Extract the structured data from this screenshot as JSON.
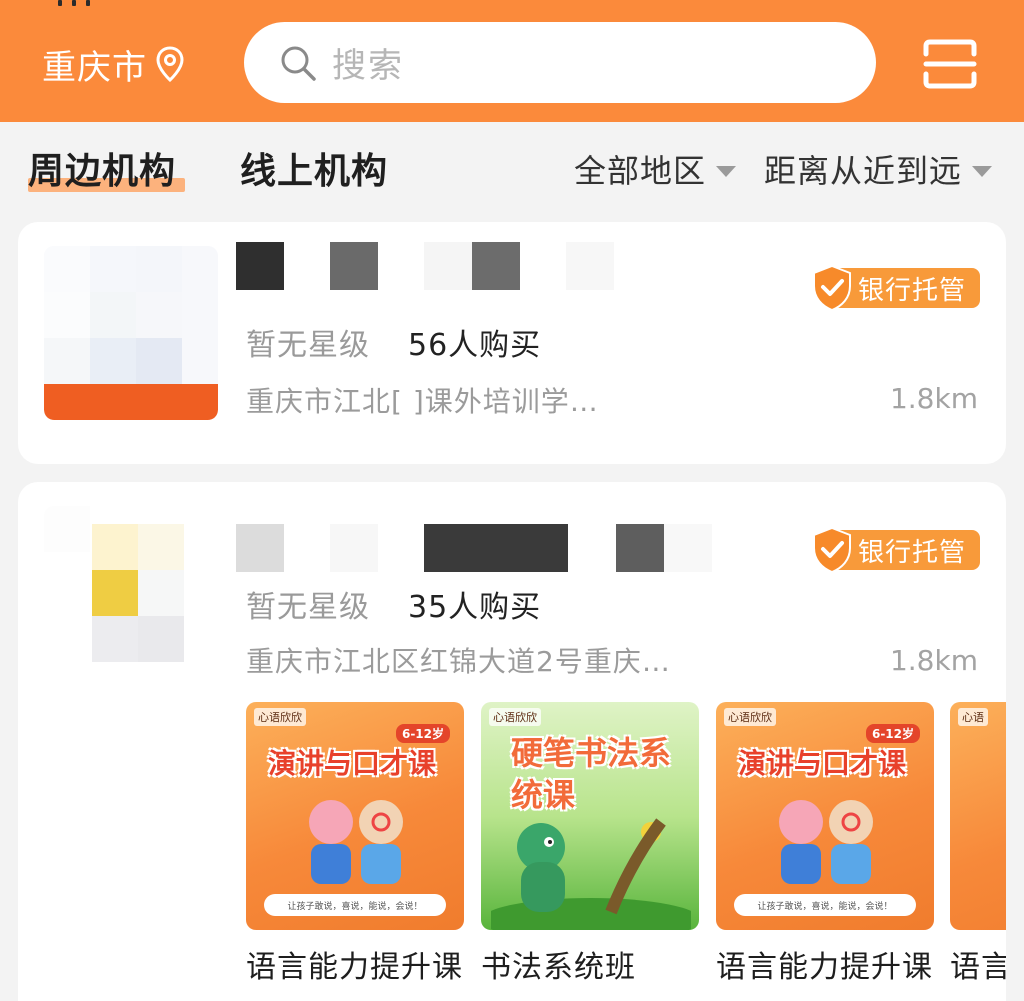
{
  "header": {
    "city": "重庆市",
    "location_icon": "location-pin-icon",
    "search_placeholder": "搜索",
    "search_icon": "search-icon",
    "scan_icon": "scan-icon",
    "accent_color": "#fb8a3b"
  },
  "tabs": [
    {
      "label": "周边机构",
      "active": true
    },
    {
      "label": "线上机构",
      "active": false
    }
  ],
  "filters": {
    "region": "全部地区",
    "sort": "距离从近到远"
  },
  "institutions": [
    {
      "rating": "暂无星级",
      "buyers": "56人购买",
      "address": "重庆市江北[      ]课外培训学…",
      "distance": "1.8km",
      "badge": "银行托管"
    },
    {
      "rating": "暂无星级",
      "buyers": "35人购买",
      "address": "重庆市江北区红锦大道2号重庆…",
      "distance": "1.8km",
      "badge": "银行托管",
      "courses": [
        {
          "title": "语言能力提升课",
          "poster_heading": "演讲与口才课",
          "poster_brand": "心语欣欣",
          "poster_age": "6-12岁",
          "poster_footer": "让孩子敢说，喜说，能说，会说！"
        },
        {
          "title": "书法系统班",
          "poster_heading": "硬笔书法系统课",
          "poster_brand": "心语欣欣"
        },
        {
          "title": "语言能力提升课",
          "poster_heading": "演讲与口才课",
          "poster_brand": "心语欣欣",
          "poster_age": "6-12岁",
          "poster_footer": "让孩子敢说，喜说，能说，会说！"
        },
        {
          "title": "语言能力提升课",
          "poster_brand": "心语"
        }
      ]
    }
  ]
}
